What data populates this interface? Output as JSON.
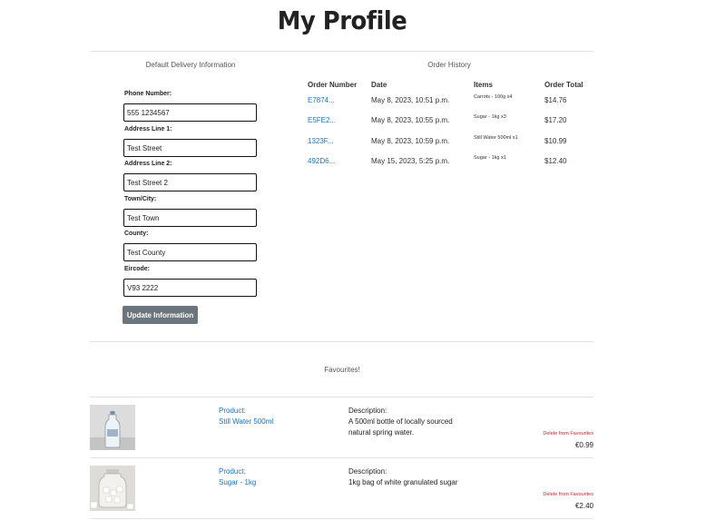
{
  "page": {
    "title": "My Profile"
  },
  "delivery": {
    "heading": "Default Delivery Information",
    "fields": [
      {
        "label": "Phone Number:",
        "value": "555 1234567"
      },
      {
        "label": "Address Line 1:",
        "value": "Test Street"
      },
      {
        "label": "Address Line 2:",
        "value": "Test Street 2"
      },
      {
        "label": "Town/City:",
        "value": "Test Town"
      },
      {
        "label": "County:",
        "value": "Test County"
      },
      {
        "label": "Eircode:",
        "value": "V93 2222"
      }
    ],
    "update_label": "Update Information"
  },
  "orders": {
    "heading": "Order History",
    "columns": [
      "Order Number",
      "Date",
      "Items",
      "Order Total"
    ],
    "rows": [
      {
        "number": "E7874...",
        "date": "May 8, 2023, 10:51 p.m.",
        "items": "Carrots - 100g x4",
        "total": "$14.76"
      },
      {
        "number": "E5FE2...",
        "date": "May 8, 2023, 10:55 p.m.",
        "items": "Sugar - 1kg x3",
        "total": "$17.20"
      },
      {
        "number": "1323F...",
        "date": "May 8, 2023, 10:59 p.m.",
        "items": "Still Water 500ml x1",
        "total": "$10.99"
      },
      {
        "number": "492D6...",
        "date": "May 15, 2023, 5:25 p.m.",
        "items": "Sugar - 1kg x1",
        "total": "$12.40"
      }
    ]
  },
  "favourites": {
    "heading": "Favourites!",
    "product_label": "Product:",
    "description_label": "Description:",
    "delete_label": "Delete from Favourites",
    "items": [
      {
        "name": "Still Water 500ml",
        "description": "A 500ml bottle of locally sourced natural spring water.",
        "price": "€0.99",
        "icon": "water-bottle-image"
      },
      {
        "name": "Sugar - 1kg",
        "description": "1kg bag of white granulated sugar",
        "price": "€2.40",
        "icon": "sugar-jar-image"
      }
    ]
  }
}
